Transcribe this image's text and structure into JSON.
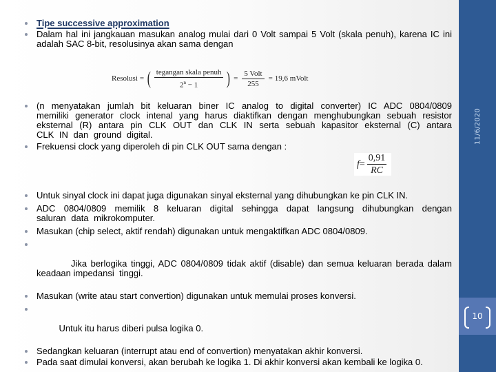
{
  "slide": {
    "section1": {
      "title": "Tipe successive approximation",
      "items": [
        "Dalam hal ini jangkauan masukan analog mulai dari 0 Volt sampai 5 Volt (skala penuh), karena IC ini adalah SAC 8-bit, resolusinya akan sama dengan"
      ]
    },
    "formula_resolution": {
      "label": "Resolusi",
      "eq": "=",
      "numerator1": "tegangan  skala penuh",
      "denominator1_base": "2",
      "denominator1_exp": "n",
      "denominator1_rest": " − 1",
      "numerator2": "5 Volt",
      "denominator2": "255",
      "result": "19,6 mVolt"
    },
    "section2": {
      "items": [
        "(n menyatakan jumlah bit keluaran biner IC analog to digital converter) IC ADC 0804/0809 memiliki generator clock intenal yang harus diaktifkan dengan menghubungkan sebuah resistor eksternal (R) antara pin CLK OUT dan CLK IN serta sebuah kapasitor eksternal (C) antara CLK IN dan ground digital.",
        "Frekuensi clock yang diperoleh di pin CLK OUT sama dengan :"
      ]
    },
    "formula_frequency": {
      "lhs": "f",
      "eq": "=",
      "numerator": "0,91",
      "denominator": "RC"
    },
    "section3": {
      "items": [
        "Untuk sinyal clock ini dapat juga digunakan sinyal eksternal yang dihubungkan ke pin CLK IN.",
        "ADC 0804/0809 memilik 8 keluaran digital sehingga dapat langsung dihubungkan dengan saluran data mikrokomputer.",
        "Masukan (chip select, aktif rendah) digunakan untuk mengaktifkan ADC 0804/0809.",
        " Jika berlogika tinggi, ADC 0804/0809 tidak aktif (disable) dan semua keluaran berada dalam keadaan impedansi  tinggi.",
        "Masukan (write atau start convertion) digunakan untuk memulai proses konversi.",
        " Untuk itu harus diberi pulsa logika 0.",
        "Sedangkan keluaran (interrupt atau end of convertion) menyatakan akhir konversi.",
        "Pada saat dimulai konversi, akan berubah ke logika 1. Di akhir konversi akan kembali ke logika 0."
      ]
    }
  },
  "sidebar": {
    "date": "11/6/2020",
    "page_number": "10",
    "colors": {
      "background": "#2e5a94",
      "page_band": "#5677b4"
    }
  },
  "colors": {
    "title": "#1f3864",
    "text": "#000000",
    "bullet": "#8a93a6"
  }
}
